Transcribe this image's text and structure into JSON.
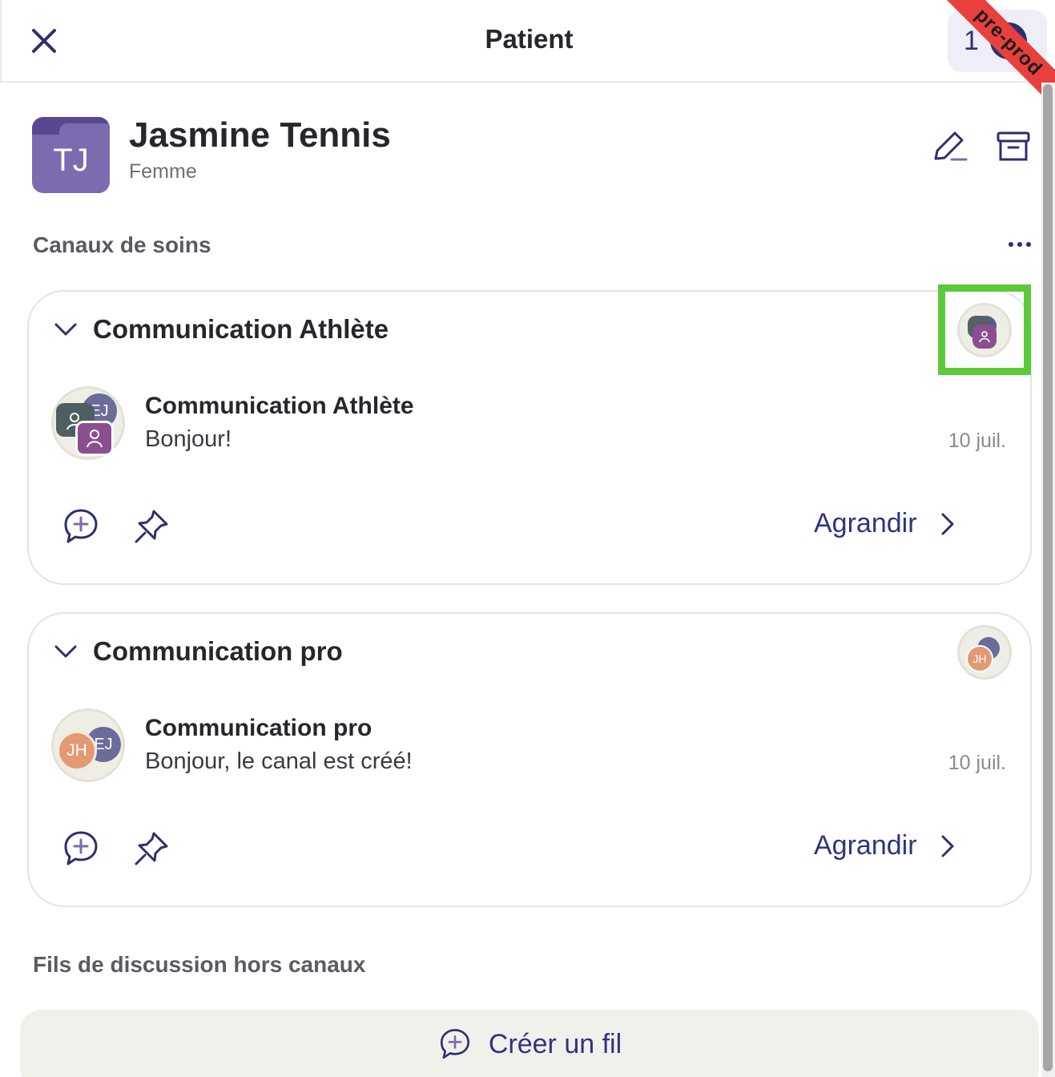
{
  "header": {
    "title": "Patient",
    "counter": "1",
    "env_badge": "pre-prod"
  },
  "patient": {
    "initials": "TJ",
    "name": "Jasmine Tennis",
    "gender": "Femme"
  },
  "sections": {
    "channels_title": "Canaux de soins",
    "threads_title": "Fils de discussion hors canaux"
  },
  "channels": [
    {
      "title": "Communication Athlète",
      "message_title": "Communication Athlète",
      "message_text": "Bonjour!",
      "date": "10 juil.",
      "avatar_initials": "EJ",
      "expand_label": "Agrandir"
    },
    {
      "title": "Communication pro",
      "message_title": "Communication pro",
      "message_text": "Bonjour, le canal est créé!",
      "date": "10 juil.",
      "avatar_initials_1": "JH",
      "avatar_initials_2": "EJ",
      "mini_initials": "JH",
      "expand_label": "Agrandir"
    }
  ],
  "create_thread": {
    "label": "Créer un fil"
  },
  "colors": {
    "accent": "#2f3480",
    "highlight": "#5cc93a",
    "avatar_purple": "#7d6bb0",
    "ribbon": "#e8403c"
  }
}
